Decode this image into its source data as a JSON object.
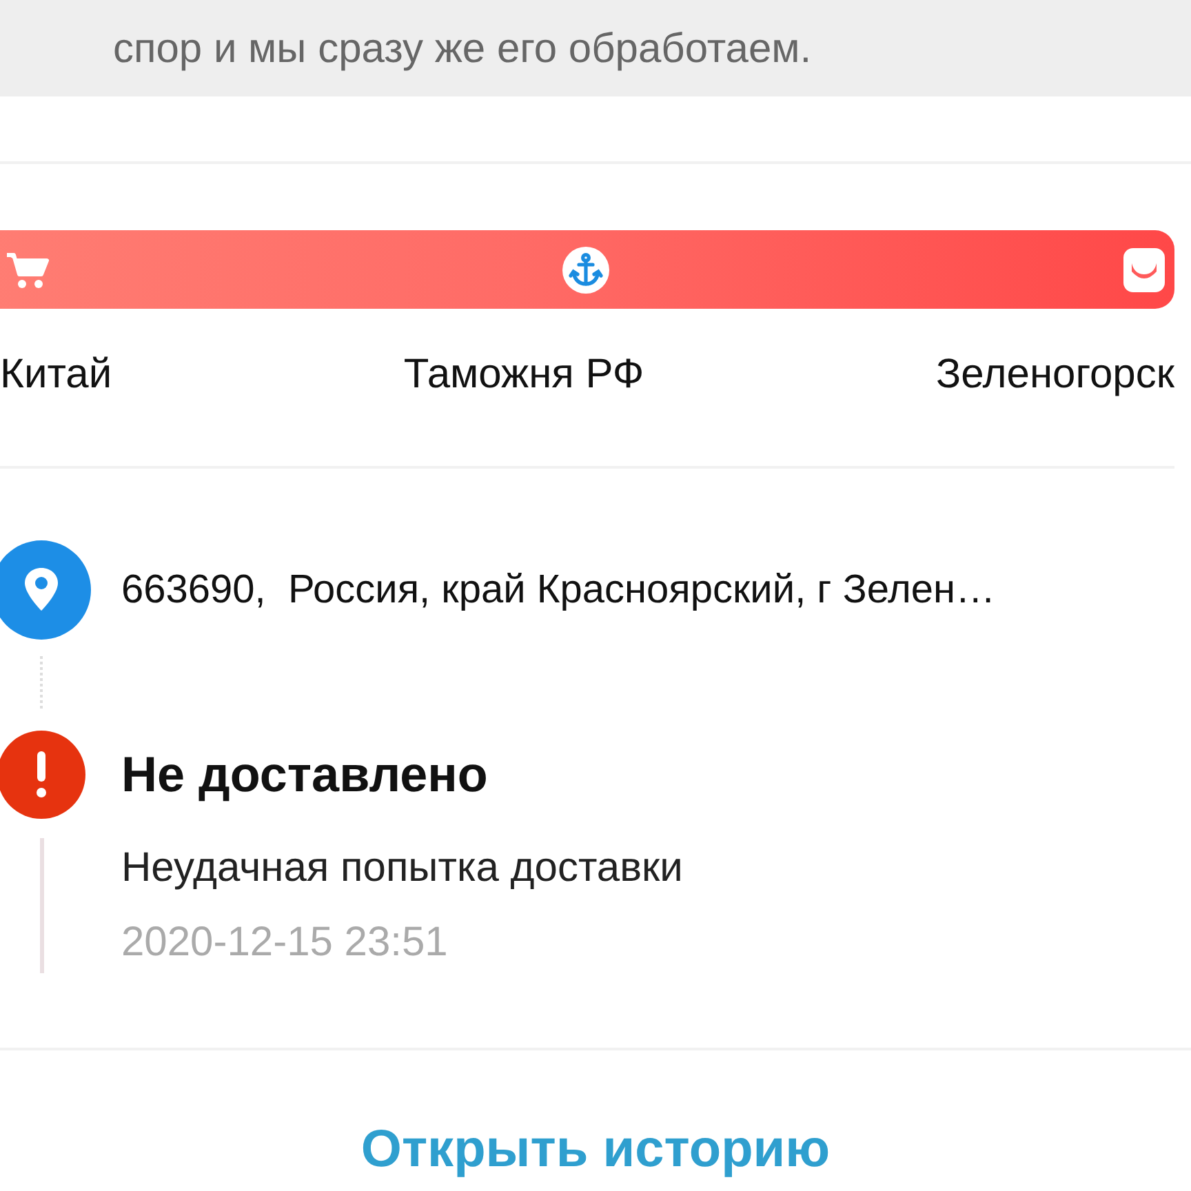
{
  "notice": {
    "text": "спор и мы сразу же его обработаем."
  },
  "route": {
    "stages": [
      {
        "label": "Китай",
        "kind": "cart",
        "selected": false
      },
      {
        "label": "Таможня РФ",
        "kind": "anchor",
        "selected": true
      },
      {
        "label": "Зеленогорск",
        "kind": "box",
        "selected": false
      }
    ]
  },
  "events": [
    {
      "kind": "address",
      "text": "663690,  Россия, край Красноярский, г Зелен…"
    },
    {
      "kind": "alert",
      "title": "Не доставлено",
      "description": "Неудачная попытка доставки",
      "time": "2020-12-15 23:51"
    }
  ],
  "history_button": "Открыть историю"
}
